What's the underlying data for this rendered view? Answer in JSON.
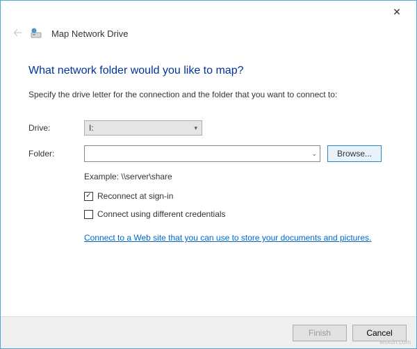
{
  "window": {
    "title": "Map Network Drive"
  },
  "heading": "What network folder would you like to map?",
  "subtext": "Specify the drive letter for the connection and the folder that you want to connect to:",
  "form": {
    "drive_label": "Drive:",
    "drive_value": "I:",
    "folder_label": "Folder:",
    "folder_value": "",
    "browse_label": "Browse...",
    "example": "Example: \\\\server\\share",
    "reconnect_label": "Reconnect at sign-in",
    "reconnect_checked": true,
    "credentials_label": "Connect using different credentials",
    "credentials_checked": false,
    "link_text": "Connect to a Web site that you can use to store your documents and pictures."
  },
  "footer": {
    "finish": "Finish",
    "cancel": "Cancel"
  },
  "watermark": "wsxdn.com"
}
